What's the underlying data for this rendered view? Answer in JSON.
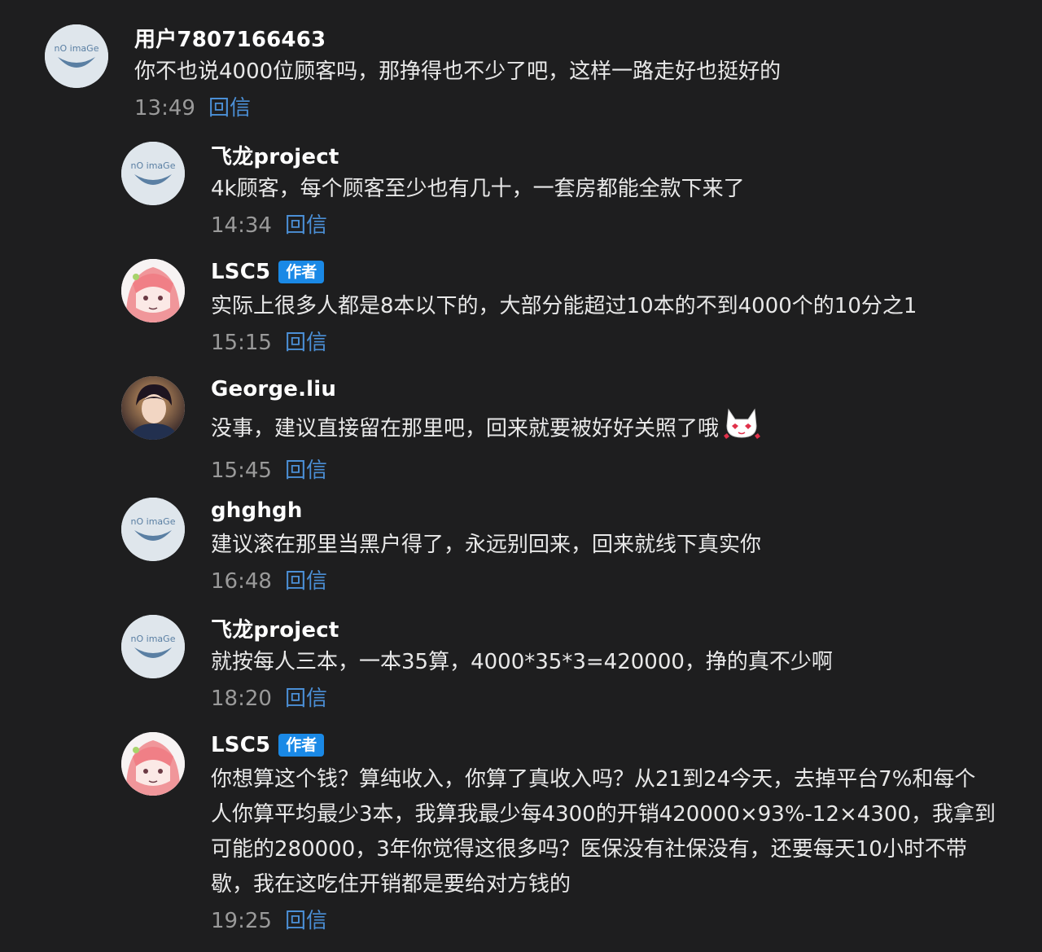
{
  "reply_label": "回信",
  "author_badge": "作者",
  "comments": [
    {
      "user": "用户7807166463",
      "avatar": "no-image-avatar",
      "text": "你不也说4000位顾客吗，那挣得也不少了吧，这样一路走好也挺好的",
      "time": "13:49"
    },
    {
      "user": "飞龙project",
      "avatar": "no-image-avatar",
      "text": "4k顾客，每个顾客至少也有几十，一套房都能全款下来了",
      "time": "14:34"
    },
    {
      "user": "LSC5",
      "avatar": "anime-pink-avatar",
      "is_author": true,
      "text": "实际上很多人都是8本以下的，大部分能超过10本的不到4000个的10分之1",
      "time": "15:15"
    },
    {
      "user": "George.liu",
      "avatar": "photo-avatar",
      "text": "没事，建议直接留在那里吧，回来就要被好好关照了哦",
      "emoji": "cat-heart-eyes-emoji",
      "time": "15:45"
    },
    {
      "user": "ghghgh",
      "avatar": "no-image-avatar",
      "text": "建议滚在那里当黑户得了，永远别回来，回来就线下真实你",
      "time": "16:48"
    },
    {
      "user": "飞龙project",
      "avatar": "no-image-avatar",
      "text": "就按每人三本，一本35算，4000*35*3=420000，挣的真不少啊",
      "time": "18:20"
    },
    {
      "user": "LSC5",
      "avatar": "anime-pink-avatar",
      "is_author": true,
      "text": "你想算这个钱？算纯收入，你算了真收入吗？从21到24今天，去掉平台7%和每个人你算平均最少3本，我算我最少每4300的开销420000×93%-12×4300，我拿到可能的280000，3年你觉得这很多吗？医保没有社保没有，还要每天10小时不带歇，我在这吃住开销都是要给对方钱的",
      "time": "19:25"
    }
  ]
}
